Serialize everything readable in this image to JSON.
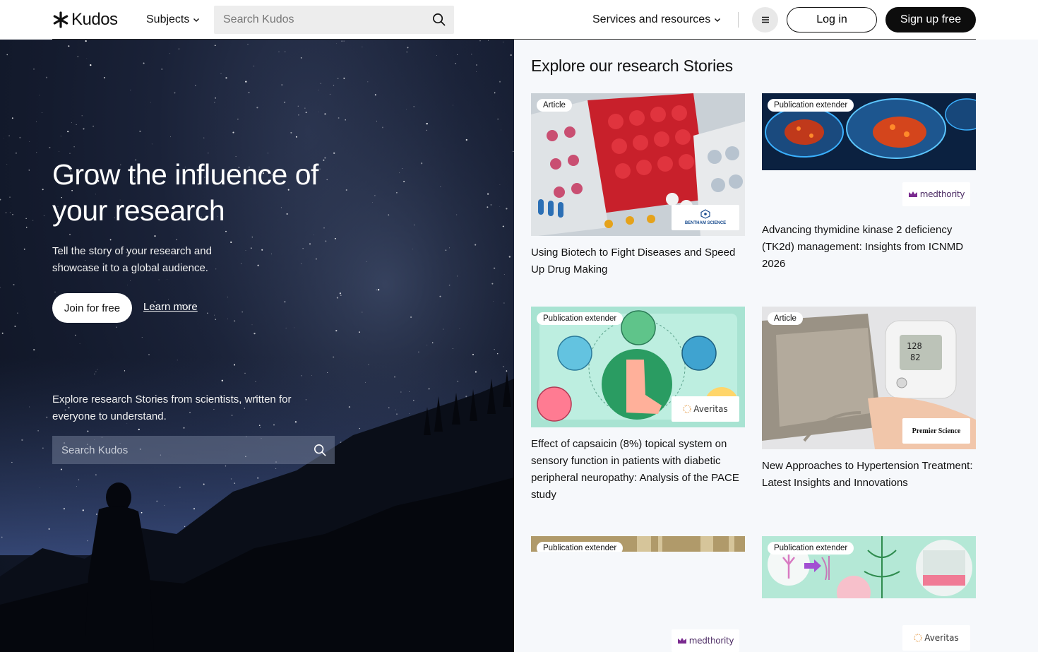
{
  "header": {
    "logo_text": "Kudos",
    "subjects_label": "Subjects",
    "search_placeholder": "Search Kudos",
    "services_label": "Services and resources",
    "login_label": "Log in",
    "signup_label": "Sign up free"
  },
  "hero": {
    "title": "Grow the influence of your research",
    "subtitle": "Tell the story of your research and showcase it to a global audience.",
    "join_label": "Join for free",
    "learn_label": "Learn more",
    "explore_text": "Explore research Stories from scientists, written for everyone to understand.",
    "search_placeholder": "Search Kudos"
  },
  "stories": {
    "title": "Explore our research Stories",
    "cards": [
      {
        "badge": "Article",
        "title": "Using Biotech to Fight Diseases and Speed Up Drug Making",
        "publisher": "BENTHAM SCIENCE"
      },
      {
        "badge": "Publication extender",
        "title": "Advancing thymidine kinase 2 deficiency (TK2d) management: Insights from ICNMD 2026",
        "publisher": "medthority"
      },
      {
        "badge": "Publication extender",
        "title": "Effect of capsaicin (8%) topical system on sensory function in patients with diabetic peripheral neuropathy: Analysis of the PACE study",
        "publisher": "Averitas"
      },
      {
        "badge": "Article",
        "title": "New Approaches to Hypertension Treatment: Latest Insights and Innovations",
        "publisher": "Premier Science"
      },
      {
        "badge": "Publication extender",
        "title": "",
        "publisher": "medthority"
      },
      {
        "badge": "Publication extender",
        "title": "",
        "publisher": "Averitas"
      }
    ]
  },
  "colors": {
    "accent_dark": "#0d0d0d",
    "hero_bg": "#141b2e",
    "page_bg": "#f6f8fb"
  }
}
